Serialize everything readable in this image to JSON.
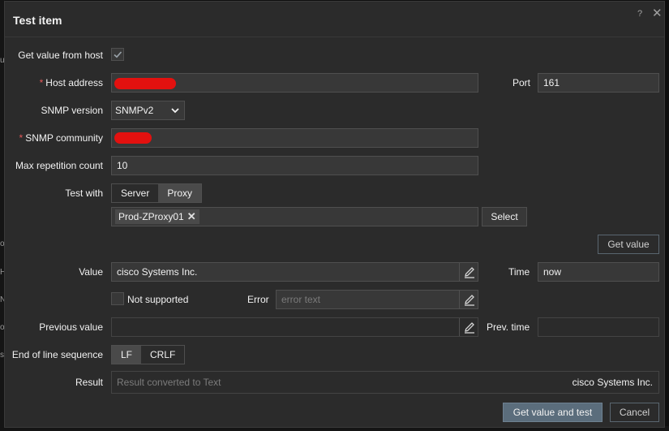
{
  "background": {
    "left_edge_glyphs": [
      "u",
      "o",
      "H",
      "N",
      "o",
      "st"
    ]
  },
  "dialog": {
    "title": "Test item",
    "help_icon": "?",
    "close_icon": "✕"
  },
  "form": {
    "get_value_from_host": {
      "label": "Get value from host",
      "checked": true
    },
    "host_address": {
      "label": "Host address",
      "required_mark": "*",
      "value_redacted": true
    },
    "port": {
      "label": "Port",
      "value": "161"
    },
    "snmp_version": {
      "label": "SNMP version",
      "selected": "SNMPv2"
    },
    "snmp_community": {
      "label": "SNMP community",
      "required_mark": "*",
      "value_redacted": true
    },
    "max_repetition_count": {
      "label": "Max repetition count",
      "value": "10"
    },
    "test_with": {
      "label": "Test with",
      "options": [
        "Server",
        "Proxy"
      ],
      "selected": "Proxy"
    },
    "proxy": {
      "chip": "Prod-ZProxy01",
      "remove_icon": "✕",
      "select_button": "Select"
    },
    "get_value_button": "Get value",
    "value": {
      "label": "Value",
      "value": "cisco Systems Inc."
    },
    "time": {
      "label": "Time",
      "value": "now"
    },
    "not_supported": {
      "label": "Not supported",
      "checked": false
    },
    "error": {
      "label": "Error",
      "placeholder": "error text"
    },
    "previous_value": {
      "label": "Previous value",
      "value": ""
    },
    "prev_time": {
      "label": "Prev. time",
      "value": ""
    },
    "end_of_line": {
      "label": "End of line sequence",
      "options": [
        "LF",
        "CRLF"
      ],
      "selected": "LF"
    },
    "result": {
      "label": "Result",
      "placeholder": "Result converted to Text",
      "value": "cisco Systems Inc."
    }
  },
  "footer": {
    "primary_button": "Get value and test",
    "cancel_button": "Cancel"
  },
  "colors": {
    "dialog_bg": "#2b2b2b",
    "input_bg": "#383838",
    "required": "#e45959",
    "primary_button": "#5b6d7c",
    "redaction": "#e3110f"
  }
}
